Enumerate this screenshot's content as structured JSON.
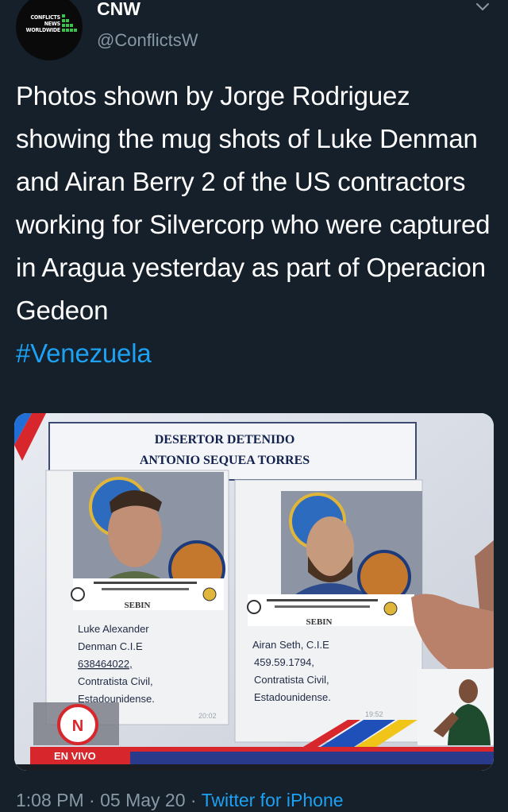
{
  "author": {
    "name": "CNW",
    "handle": "@ConflictsW",
    "avatar_text": [
      "CONFLICTS",
      "NEWS",
      "WORLDWIDE"
    ]
  },
  "tweet": {
    "text": "Photos shown by Jorge Rodriguez showing the mug shots of Luke Denman and Airan Berry 2 of the US contractors working for Silvercorp who were captured in Aragua yesterday as part of Operacion Gedeon",
    "hashtag": "#Venezuela"
  },
  "media": {
    "title_line1": "DESERTOR DETENIDO",
    "title_line2": "ANTONIO SEQUEA TORRES",
    "card_left": {
      "header": "SEBIN",
      "lines": [
        "Luke Alexander",
        "Denman C.I.E",
        "638464022,",
        "Contratista Civil,",
        "Estadounidense."
      ],
      "time": "20:02"
    },
    "card_right": {
      "header": "SEBIN",
      "lines": [
        "Airan Seth, C.I.E",
        "459.59.1794,",
        "Contratista Civil,",
        "Estadounidense."
      ],
      "time": "19:52"
    },
    "live_label": "EN VIVO",
    "channel_logo": "N"
  },
  "footer": {
    "time": "1:08 PM",
    "sep1": "·",
    "date": "05 May 20",
    "sep2": "·",
    "source": "Twitter for iPhone"
  },
  "colors": {
    "background": "#15202b",
    "secondary_text": "#8899a6",
    "link": "#1da1f2"
  },
  "icons": {
    "menu": "chevron-down-icon"
  }
}
